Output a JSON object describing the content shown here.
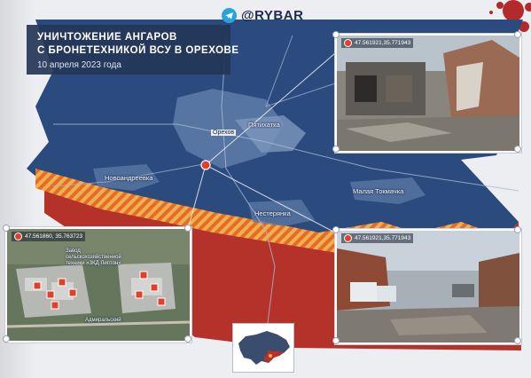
{
  "brand": {
    "name": "@RYBAR",
    "icon": "telegram-icon"
  },
  "header": {
    "title_line1": "УНИЧТОЖЕНИЕ АНГАРОВ",
    "title_line2": "С БРОНЕТЕХНИКОЙ ВСУ В ОРЕХОВЕ",
    "date": "10 апреля 2023 года"
  },
  "map": {
    "places": {
      "orekhov": "Орехов",
      "pyatikhatka": "Пятихатка",
      "novoandreevka": "Новоандреевка",
      "malaya_tokmachka": "Малая Токмачка",
      "nesterianka": "Нестерянка"
    },
    "colors": {
      "territory": "#2b4a7e",
      "frontline_hatch": "#f0a23a",
      "russian_zone": "#b5322a",
      "pin": "#e0412d"
    }
  },
  "satellite": {
    "coords": "47.561860, 35.763723",
    "plant_label": "Завод сельскохозяйственной техники «ЗКД Липтон»",
    "street_label": "Адмиральский"
  },
  "photo_top": {
    "coords": "47.561921,35.771943"
  },
  "photo_bottom": {
    "coords": "47.561921,35.771943"
  },
  "inset": {
    "icon": "ukraine-locator-map-icon"
  }
}
